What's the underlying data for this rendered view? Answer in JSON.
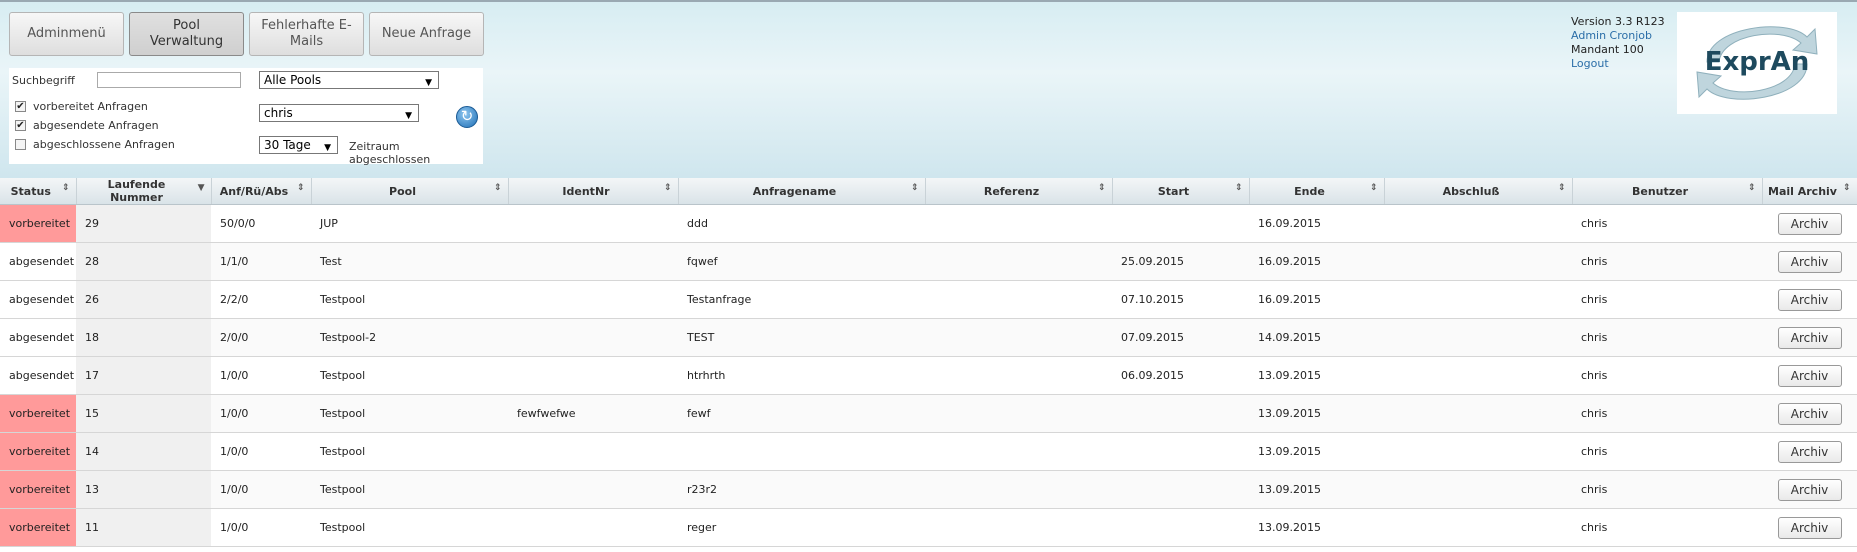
{
  "nav": {
    "admin_menu": "Adminmenü",
    "pool_admin": "Pool Verwaltung",
    "faulty_mails": "Fehlerhafte E-Mails",
    "new_request": "Neue Anfrage"
  },
  "filter": {
    "search_label": "Suchbegriff",
    "search_value": "",
    "pool_select": "Alle Pools",
    "user_select": "chris",
    "period_select": "30 Tage",
    "period_label": "Zeitraum abgeschlossen",
    "cb_prepared": "vorbereitet Anfragen",
    "cb_sent": "abgesendete Anfragen",
    "cb_closed": "abgeschlossene Anfragen"
  },
  "info": {
    "version": "Version 3.3 R123",
    "admin_link": "Admin Cronjob",
    "mandant": "Mandant 100",
    "logout": "Logout",
    "logo_text": "ExprAn"
  },
  "table": {
    "headers": [
      "Status",
      "Laufende Nummer",
      "Anf/Rü/Abs",
      "Pool",
      "IdentNr",
      "Anfragename",
      "Referenz",
      "Start",
      "Ende",
      "Abschluß",
      "Benutzer",
      "Mail Archiv"
    ],
    "archive_label": "Archiv",
    "rows": [
      {
        "status": "vorbereitet",
        "nr": "29",
        "anf": "50/0/0",
        "pool": "JUP",
        "ident": "",
        "name": "ddd",
        "ref": "",
        "start": "",
        "ende": "16.09.2015",
        "abschluss": "",
        "user": "chris"
      },
      {
        "status": "abgesendet",
        "nr": "28",
        "anf": "1/1/0",
        "pool": "Test",
        "ident": "",
        "name": "fqwef",
        "ref": "",
        "start": "25.09.2015",
        "ende": "16.09.2015",
        "abschluss": "",
        "user": "chris"
      },
      {
        "status": "abgesendet",
        "nr": "26",
        "anf": "2/2/0",
        "pool": "Testpool",
        "ident": "",
        "name": "Testanfrage",
        "ref": "",
        "start": "07.10.2015",
        "ende": "16.09.2015",
        "abschluss": "",
        "user": "chris"
      },
      {
        "status": "abgesendet",
        "nr": "18",
        "anf": "2/0/0",
        "pool": "Testpool-2",
        "ident": "",
        "name": "TEST",
        "ref": "",
        "start": "07.09.2015",
        "ende": "14.09.2015",
        "abschluss": "",
        "user": "chris"
      },
      {
        "status": "abgesendet",
        "nr": "17",
        "anf": "1/0/0",
        "pool": "Testpool",
        "ident": "",
        "name": "htrhrth",
        "ref": "",
        "start": "06.09.2015",
        "ende": "13.09.2015",
        "abschluss": "",
        "user": "chris"
      },
      {
        "status": "vorbereitet",
        "nr": "15",
        "anf": "1/0/0",
        "pool": "Testpool",
        "ident": "fewfwefwe",
        "name": "fewf",
        "ref": "",
        "start": "",
        "ende": "13.09.2015",
        "abschluss": "",
        "user": "chris"
      },
      {
        "status": "vorbereitet",
        "nr": "14",
        "anf": "1/0/0",
        "pool": "Testpool",
        "ident": "",
        "name": "",
        "ref": "",
        "start": "",
        "ende": "13.09.2015",
        "abschluss": "",
        "user": "chris"
      },
      {
        "status": "vorbereitet",
        "nr": "13",
        "anf": "1/0/0",
        "pool": "Testpool",
        "ident": "",
        "name": "r23r2",
        "ref": "",
        "start": "",
        "ende": "13.09.2015",
        "abschluss": "",
        "user": "chris"
      },
      {
        "status": "vorbereitet",
        "nr": "11",
        "anf": "1/0/0",
        "pool": "Testpool",
        "ident": "",
        "name": "reger",
        "ref": "",
        "start": "",
        "ende": "13.09.2015",
        "abschluss": "",
        "user": "chris"
      }
    ]
  }
}
